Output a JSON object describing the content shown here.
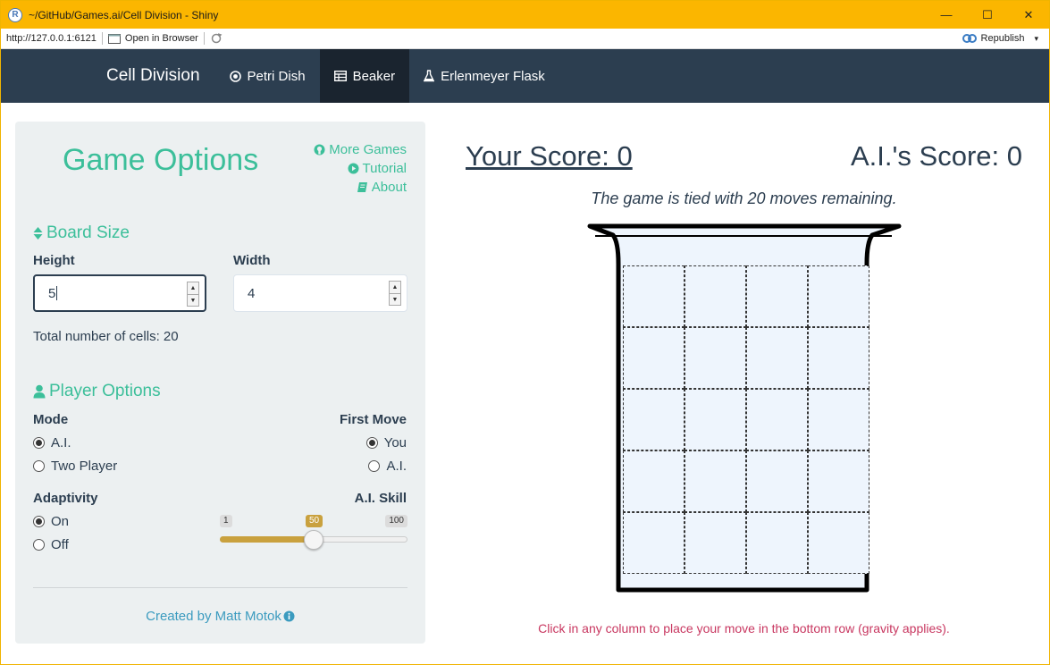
{
  "window": {
    "title": "~/GitHub/Games.ai/Cell Division - Shiny",
    "app_icon": "R",
    "controls": {
      "minimize": "—",
      "maximize": "☐",
      "close": "✕"
    }
  },
  "address_bar": {
    "url": "http://127.0.0.1:6121",
    "open_in_browser": "Open in Browser",
    "republish": "Republish",
    "republish_caret": "▾"
  },
  "navbar": {
    "brand": "Cell Division",
    "tabs": [
      {
        "label": "Petri Dish",
        "icon": "dot-circle-icon"
      },
      {
        "label": "Beaker",
        "icon": "table-icon",
        "active": true
      },
      {
        "label": "Erlenmeyer Flask",
        "icon": "flask-icon"
      }
    ],
    "bg_color": "#2c3e50",
    "active_color": "#1a242f"
  },
  "sidebar": {
    "title": "Game Options",
    "links": {
      "more_games": "More Games",
      "tutorial": "Tutorial",
      "about": "About"
    },
    "board_size": {
      "header": "Board Size",
      "height_label": "Height",
      "height_value": "5",
      "width_label": "Width",
      "width_value": "4",
      "total_cells": "Total number of cells: 20"
    },
    "player_options": {
      "header": "Player Options",
      "mode_label": "Mode",
      "mode_options": [
        "A.I.",
        "Two Player"
      ],
      "mode_selected": "A.I.",
      "first_move_label": "First Move",
      "first_move_options": [
        "You",
        "A.I."
      ],
      "first_move_selected": "You",
      "adaptivity_label": "Adaptivity",
      "adaptivity_options": [
        "On",
        "Off"
      ],
      "adaptivity_selected": "On",
      "skill_label": "A.I. Skill",
      "skill_min": "1",
      "skill_max": "100",
      "skill_value": "50",
      "skill_fraction": 0.5
    },
    "credit": "Created by Matt Motok",
    "accent_color": "#3cbf9a"
  },
  "game": {
    "your_score": "Your Score: 0",
    "ai_score": "A.I.'s Score: 0",
    "status": "The game is tied with 20 moves remaining.",
    "rows": 5,
    "cols": 4,
    "instruction": "Click in any column to place your move in the bottom row (gravity applies).",
    "instruction_color": "#c83760"
  }
}
